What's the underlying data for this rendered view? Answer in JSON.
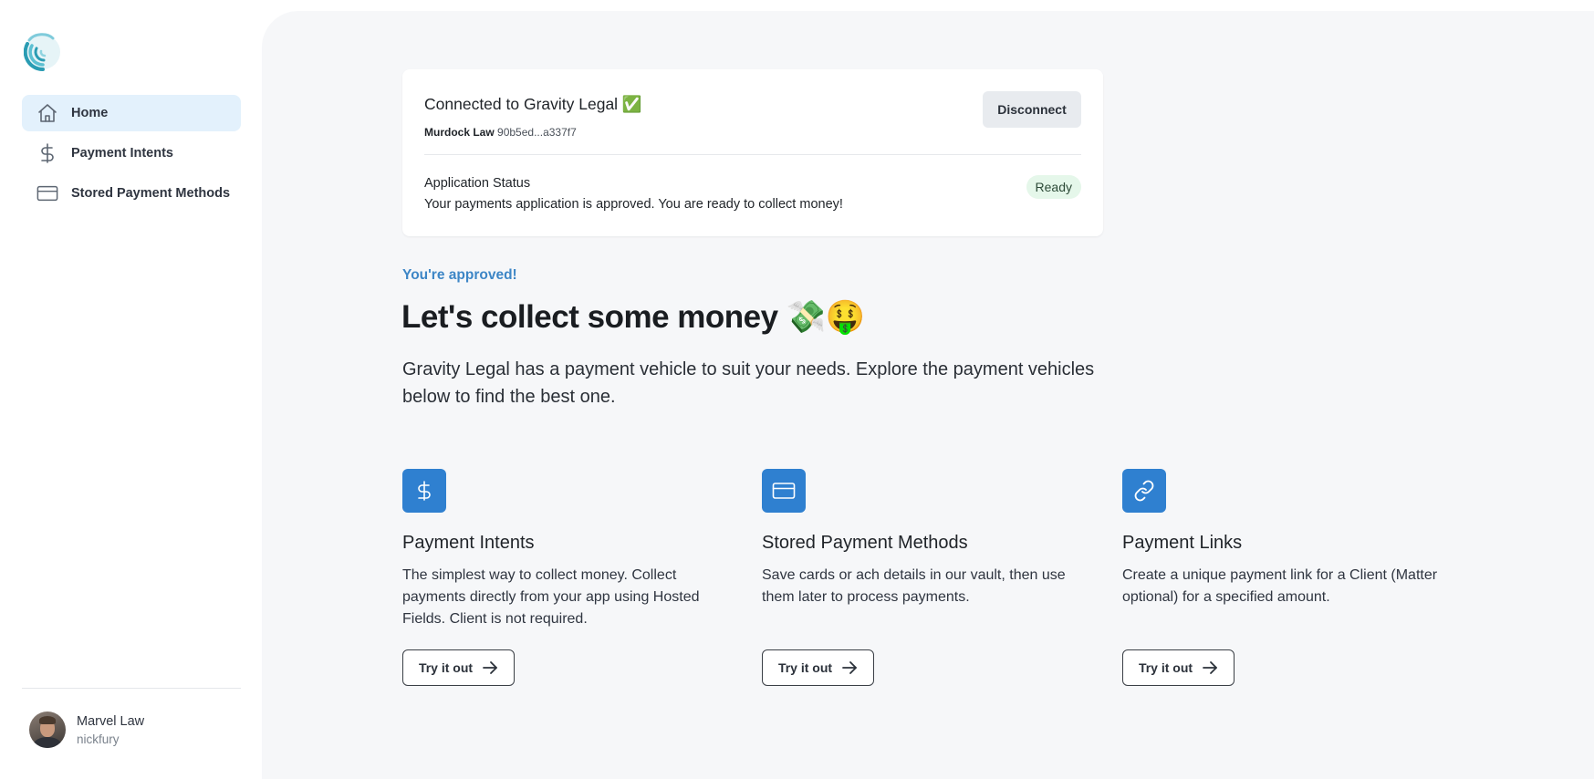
{
  "sidebar": {
    "items": [
      {
        "label": "Home",
        "icon": "home-icon",
        "active": true
      },
      {
        "label": "Payment Intents",
        "icon": "dollar-icon"
      },
      {
        "label": "Stored Payment Methods",
        "icon": "card-icon"
      }
    ],
    "user": {
      "name": "Marvel Law",
      "handle": "nickfury"
    }
  },
  "connection": {
    "title": "Connected to Gravity Legal ✅",
    "org": "Murdock Law",
    "id": "90b5ed...a337f7",
    "disconnect_label": "Disconnect",
    "status_label": "Application Status",
    "status_desc": "Your payments application is approved. You are ready to collect money!",
    "status_badge": "Ready"
  },
  "hero": {
    "eyebrow": "You're approved!",
    "headline": "Let's collect some money 💸🤑",
    "lead": "Gravity Legal has a payment vehicle to suit your needs. Explore the payment vehicles below to find the best one."
  },
  "features": [
    {
      "title": "Payment Intents",
      "desc": "The simplest way to collect money. Collect payments directly from your app using Hosted Fields. Client is not required.",
      "button": "Try it out",
      "icon": "dollar-icon"
    },
    {
      "title": "Stored Payment Methods",
      "desc": "Save cards or ach details in our vault, then use them later to process payments.",
      "button": "Try it out",
      "icon": "card-icon"
    },
    {
      "title": "Payment Links",
      "desc": "Create a unique payment link for a Client (Matter optional) for a specified amount.",
      "button": "Try it out",
      "icon": "link-icon"
    }
  ],
  "colors": {
    "accent": "#2f80d0",
    "eyebrow": "#3d86c6",
    "active_nav": "#e3f1fc",
    "badge_bg": "#e5f7ea",
    "main_bg": "#f6f7f9"
  }
}
